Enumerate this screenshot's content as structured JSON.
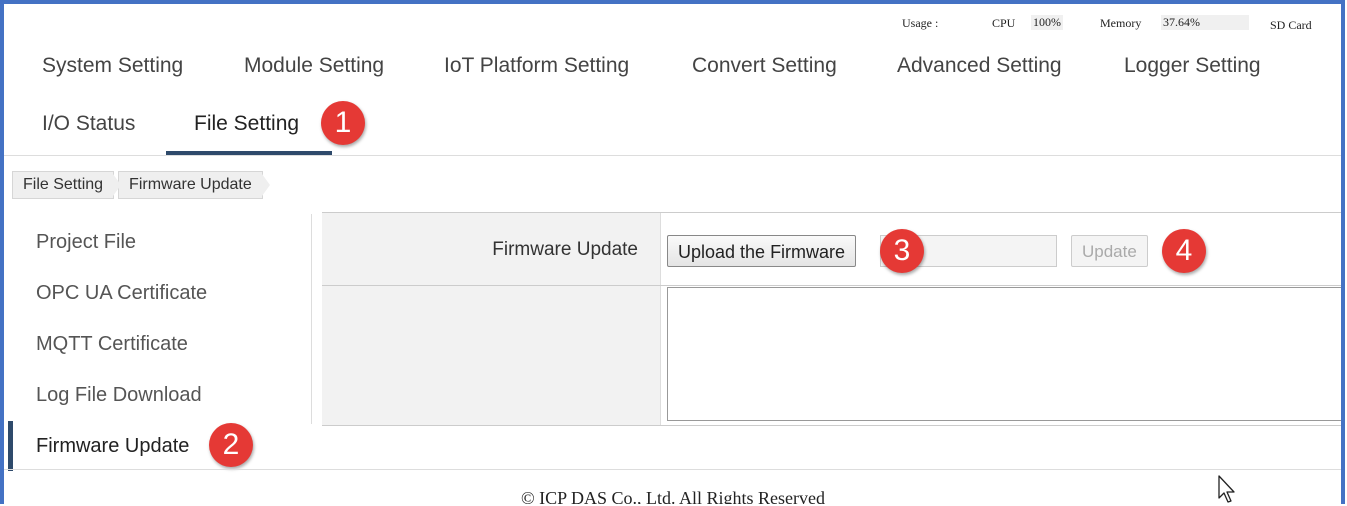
{
  "status": {
    "usage_label": "Usage :",
    "cpu_label": "CPU",
    "cpu_value": "100%",
    "memory_label": "Memory",
    "memory_value": "37.64%",
    "sd_card_label": "SD Card"
  },
  "nav": {
    "row1": [
      "System Setting",
      "Module Setting",
      "IoT Platform Setting",
      "Convert Setting",
      "Advanced Setting",
      "Logger Setting"
    ],
    "row2": [
      "I/O Status",
      "File Setting"
    ],
    "active": "File Setting"
  },
  "breadcrumb": [
    "File Setting",
    "Firmware Update"
  ],
  "sidebar": {
    "items": [
      "Project File",
      "OPC UA Certificate",
      "MQTT Certificate",
      "Log File Download",
      "Firmware Update"
    ],
    "active": "Firmware Update"
  },
  "main": {
    "row_label": "Firmware Update",
    "upload_button": "Upload the Firmware",
    "update_button": "Update"
  },
  "annotations": [
    "1",
    "2",
    "3",
    "4"
  ],
  "footer": "© ICP DAS Co., Ltd. All Rights Reserved",
  "colors": {
    "frame_border": "#4472c4",
    "accent": "#2e4a6b",
    "badge": "#e53935"
  },
  "icons": {
    "cursor": "mouse-pointer-icon"
  }
}
